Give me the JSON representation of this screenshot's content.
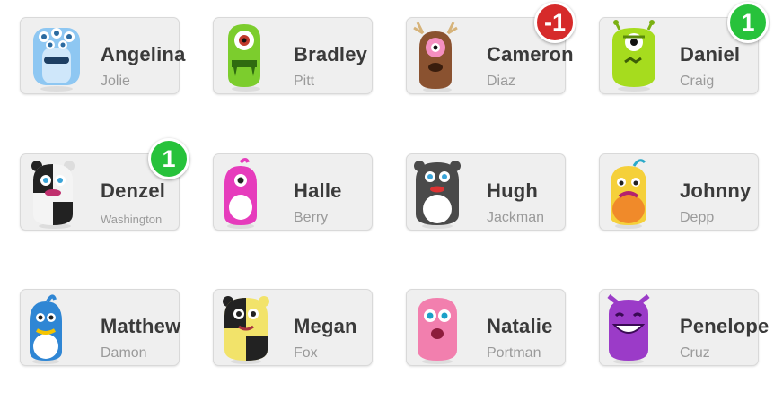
{
  "students": [
    {
      "first": "Angelina",
      "last": "Jolie",
      "avatar": "blue-five-eyed-monster-icon",
      "color": "#8ec7f2",
      "badge": ""
    },
    {
      "first": "Bradley",
      "last": "Pitt",
      "avatar": "green-cyclops-monster-icon",
      "color": "#7ccd2d",
      "badge": ""
    },
    {
      "first": "Cameron",
      "last": "Diaz",
      "avatar": "brown-antlered-monster-icon",
      "color": "#8a5230",
      "badge": "-1",
      "badge_type": "neg"
    },
    {
      "first": "Daniel",
      "last": "Craig",
      "avatar": "lime-grumpy-monster-icon",
      "color": "#a6dc1e",
      "badge": "1",
      "badge_type": "pos"
    },
    {
      "first": "Denzel",
      "last": "Washington",
      "avatar": "black-white-panda-monster-icon",
      "color": "#2a2a2a",
      "badge": "1",
      "badge_type": "pos"
    },
    {
      "first": "Halle",
      "last": "Berry",
      "avatar": "pink-horned-monster-icon",
      "color": "#e63cbc",
      "badge": ""
    },
    {
      "first": "Hugh",
      "last": "Jackman",
      "avatar": "gray-bear-monster-icon",
      "color": "#4a4a4a",
      "badge": ""
    },
    {
      "first": "Johnny",
      "last": "Depp",
      "avatar": "orange-sad-monster-icon",
      "color": "#f3a534",
      "badge": ""
    },
    {
      "first": "Matthew",
      "last": "Damon",
      "avatar": "blue-crested-monster-icon",
      "color": "#2f86d4",
      "badge": ""
    },
    {
      "first": "Megan",
      "last": "Fox",
      "avatar": "yellow-black-monster-icon",
      "color": "#f2e36a",
      "badge": ""
    },
    {
      "first": "Natalie",
      "last": "Portman",
      "avatar": "pink-fluffy-monster-icon",
      "color": "#f27fae",
      "badge": ""
    },
    {
      "first": "Penelope",
      "last": "Cruz",
      "avatar": "purple-grinning-monster-icon",
      "color": "#9b3bc8",
      "badge": ""
    }
  ]
}
